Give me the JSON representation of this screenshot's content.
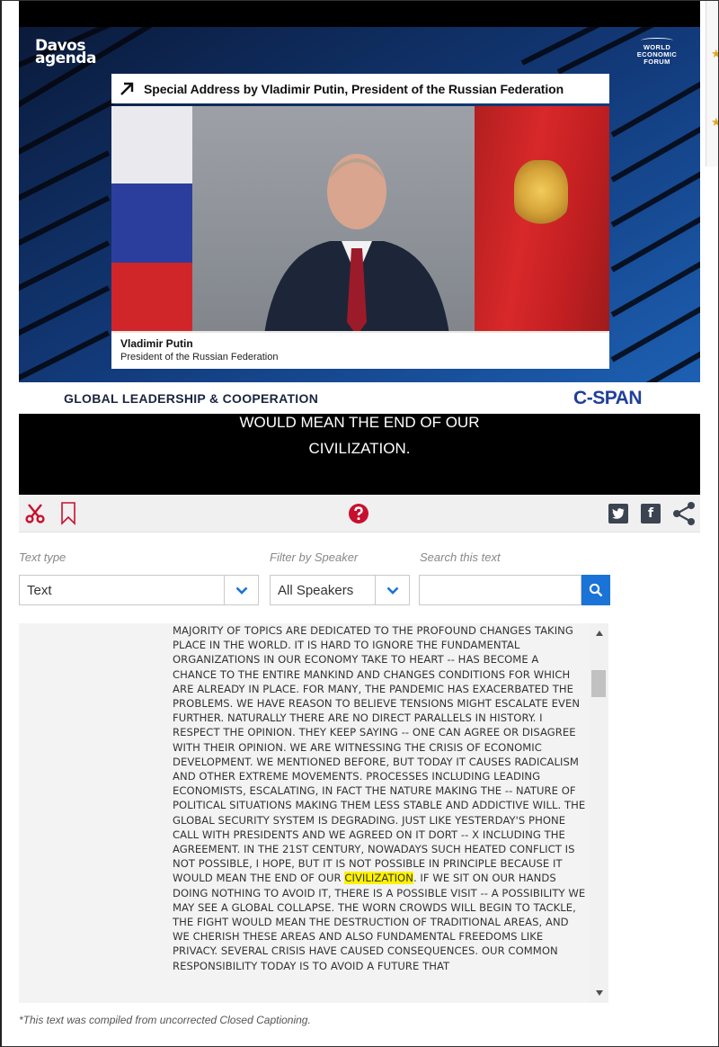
{
  "video": {
    "davos_logo_line1": "Davos",
    "davos_logo_line2": "agenda",
    "wef_logo_line1": "WORLD",
    "wef_logo_line2": "ECONOMIC",
    "wef_logo_line3": "FORUM",
    "session_title": "Special Address by Vladimir Putin, President of the Russian Federation",
    "speaker_name": "Vladimir Putin",
    "speaker_title": "President of the Russian Federation",
    "lower_third_topic": "GLOBAL LEADERSHIP & COOPERATION",
    "network_logo": "C-SPAN",
    "caption_line1": "WOULD MEAN THE END OF OUR",
    "caption_line2": "CIVILIZATION."
  },
  "toolbar": {
    "clip_icon": "scissors-icon",
    "bookmark_icon": "bookmark-icon",
    "help_icon": "question-circle-icon",
    "twitter_icon": "twitter-icon",
    "facebook_icon": "facebook-icon",
    "share_icon": "share-icon",
    "accent_color": "#c8102e"
  },
  "filters": {
    "text_type_label": "Text type",
    "text_type_value": "Text",
    "speaker_label": "Filter by Speaker",
    "speaker_value": "All Speakers",
    "search_label": "Search this text",
    "search_value": ""
  },
  "transcript": {
    "before_highlight": "MAJORITY OF TOPICS ARE DEDICATED TO THE PROFOUND CHANGES TAKING PLACE IN THE WORLD. IT IS HARD TO IGNORE THE FUNDAMENTAL ORGANIZATIONS IN OUR ECONOMY TAKE TO HEART -- HAS BECOME A CHANCE TO THE ENTIRE MANKIND AND CHANGES CONDITIONS FOR WHICH ARE ALREADY IN PLACE. FOR MANY, THE PANDEMIC HAS EXACERBATED THE PROBLEMS. WE HAVE REASON TO BELIEVE TENSIONS MIGHT ESCALATE EVEN FURTHER. NATURALLY THERE ARE NO DIRECT PARALLELS IN HISTORY. I RESPECT THE OPINION. THEY KEEP SAYING -- ONE CAN AGREE OR DISAGREE WITH THEIR OPINION. WE ARE WITNESSING THE CRISIS OF ECONOMIC DEVELOPMENT. WE MENTIONED BEFORE, BUT TODAY IT CAUSES RADICALISM AND OTHER EXTREME MOVEMENTS. PROCESSES INCLUDING LEADING ECONOMISTS, ESCALATING, IN FACT THE NATURE MAKING THE -- NATURE OF POLITICAL SITUATIONS MAKING THEM LESS STABLE AND ADDICTIVE WILL. THE GLOBAL SECURITY SYSTEM IS DEGRADING. JUST LIKE YESTERDAY'S PHONE CALL WITH PRESIDENTS AND WE AGREED ON IT DORT -- X INCLUDING THE AGREEMENT. IN THE 21ST CENTURY, NOWADAYS SUCH HEATED CONFLICT IS NOT POSSIBLE, I HOPE, BUT IT IS NOT POSSIBLE IN PRINCIPLE BECAUSE IT WOULD MEAN THE END OF OUR ",
    "highlight": "CIVILIZATION",
    "after_highlight": ". IF WE SIT ON OUR HANDS DOING NOTHING TO AVOID IT, THERE IS A POSSIBLE VISIT -- A POSSIBILITY WE MAY SEE A GLOBAL COLLAPSE. THE WORN CROWDS WILL BEGIN TO TACKLE, THE FIGHT WOULD MEAN THE DESTRUCTION OF TRADITIONAL AREAS, AND WE CHERISH THESE AREAS AND ALSO FUNDAMENTAL FREEDOMS LIKE PRIVACY. SEVERAL CRISIS HAVE CAUSED CONSEQUENCES. OUR COMMON RESPONSIBILITY TODAY IS TO AVOID A FUTURE THAT",
    "highlight_color": "#fff200"
  },
  "footnote": "*This text was compiled from uncorrected Closed Captioning."
}
